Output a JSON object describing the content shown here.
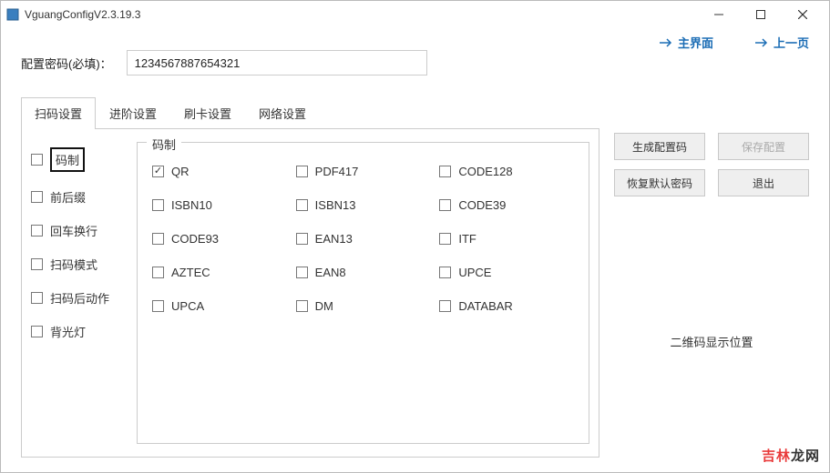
{
  "window": {
    "title": "VguangConfigV2.3.19.3"
  },
  "header": {
    "password_label": "配置密码(必填)：",
    "password_value": "1234567887654321",
    "nav_main": "主界面",
    "nav_prev": "上一页"
  },
  "tabs": [
    "扫码设置",
    "进阶设置",
    "刷卡设置",
    "网络设置"
  ],
  "side": [
    "码制",
    "前后缀",
    "回车换行",
    "扫码模式",
    "扫码后动作",
    "背光灯"
  ],
  "fieldset": {
    "legend": "码制"
  },
  "codes": [
    "QR",
    "PDF417",
    "CODE128",
    "ISBN10",
    "ISBN13",
    "CODE39",
    "CODE93",
    "EAN13",
    "ITF",
    "AZTEC",
    "EAN8",
    "UPCE",
    "UPCA",
    "DM",
    "DATABAR"
  ],
  "buttons": {
    "generate": "生成配置码",
    "save": "保存配置",
    "restore": "恢复默认密码",
    "exit": "退出"
  },
  "right": {
    "qr_label": "二维码显示位置"
  },
  "watermark": {
    "a": "吉林",
    "b": "龙网"
  }
}
